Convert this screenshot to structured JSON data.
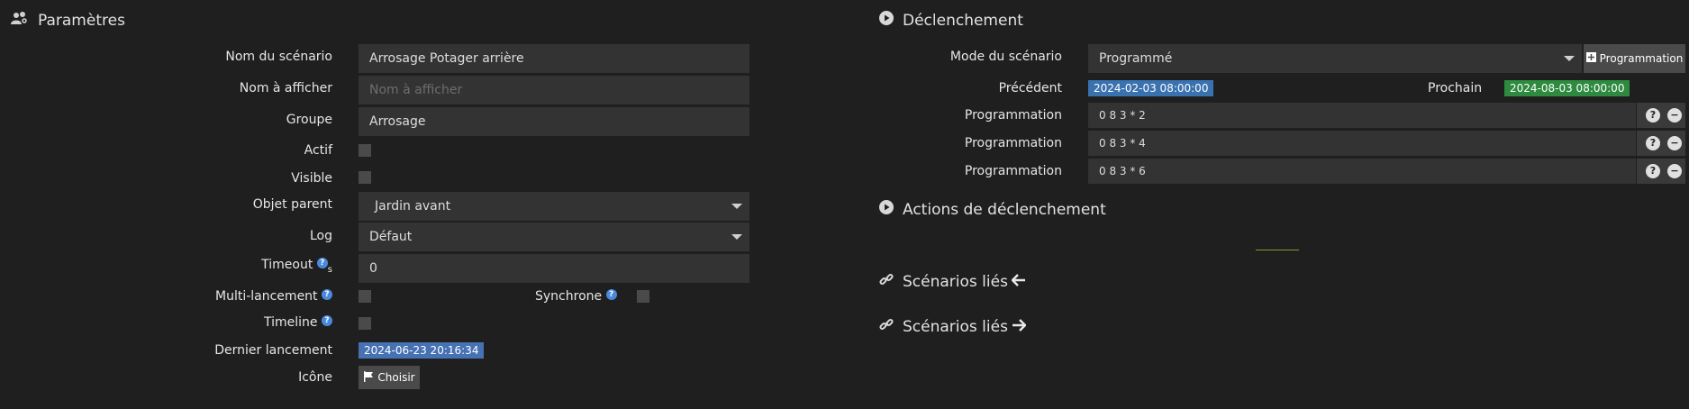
{
  "left": {
    "title": "Paramètres",
    "scenario_name_label": "Nom du scénario",
    "scenario_name_value": "Arrosage Potager arrière",
    "display_name_label": "Nom à afficher",
    "display_name_placeholder": "Nom à afficher",
    "group_label": "Groupe",
    "group_value": "Arrosage",
    "active_label": "Actif",
    "visible_label": "Visible",
    "parent_label": "Objet parent",
    "parent_value": "Jardin avant",
    "log_label": "Log",
    "log_value": "Défaut",
    "timeout_label": "Timeout",
    "timeout_unit": "s",
    "timeout_value": "0",
    "multi_label": "Multi-lancement",
    "sync_label": "Synchrone",
    "timeline_label": "Timeline",
    "last_run_label": "Dernier lancement",
    "last_run_value": "2024-06-23 20:16:34",
    "icon_label": "Icône",
    "choose_label": "Choisir"
  },
  "right": {
    "title": "Déclenchement",
    "mode_label": "Mode du scénario",
    "mode_value": "Programmé",
    "add_prog_label": "Programmation",
    "previous_label": "Précédent",
    "previous_value": "2024-02-03 08:00:00",
    "next_label": "Prochain",
    "next_value": "2024-08-03 08:00:00",
    "programmations": [
      {
        "label": "Programmation",
        "value": "0 8 3 * 2"
      },
      {
        "label": "Programmation",
        "value": "0 8 3 * 4"
      },
      {
        "label": "Programmation",
        "value": "0 8 3 * 6"
      }
    ],
    "actions_title": "Actions de déclenchement",
    "linked_in_title": "Scénarios liés",
    "linked_out_title": "Scénarios liés"
  },
  "colors": {
    "background": "#1f1f1f",
    "field": "#333333",
    "badge_blue": "#3a72b0",
    "badge_green": "#2d8a3e",
    "help_blue": "#4a89dc"
  },
  "icons": [
    "users-cog-icon",
    "play-circle-icon",
    "link-icon",
    "arrow-left-icon",
    "arrow-right-icon",
    "flag-icon",
    "question-circle-icon",
    "minus-circle-icon",
    "plus-square-icon",
    "caret-down-icon"
  ]
}
